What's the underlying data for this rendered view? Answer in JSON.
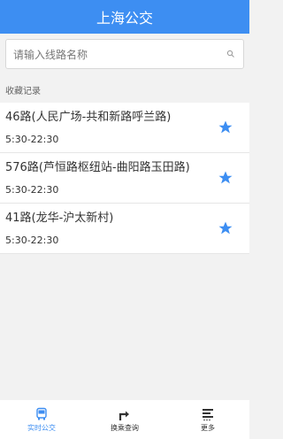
{
  "header": {
    "title": "上海公交"
  },
  "search": {
    "placeholder": "请输入线路名称"
  },
  "favorites": {
    "section_label": "收藏记录",
    "items": [
      {
        "name": "46路(人民广场-共和新路呼兰路)",
        "hours": "5:30-22:30"
      },
      {
        "name": "576路(芦恒路枢纽站-曲阳路玉田路)",
        "hours": "5:30-22:30"
      },
      {
        "name": "41路(龙华-沪太新村)",
        "hours": "5:30-22:30"
      }
    ]
  },
  "tabbar": {
    "tabs": [
      {
        "label": "实时公交",
        "icon": "bus-icon",
        "active": true
      },
      {
        "label": "换乘查询",
        "icon": "route-turn-icon",
        "active": false
      },
      {
        "label": "更多",
        "icon": "menu-lines-icon",
        "active": false
      }
    ]
  },
  "colors": {
    "accent": "#3d8ef2"
  }
}
